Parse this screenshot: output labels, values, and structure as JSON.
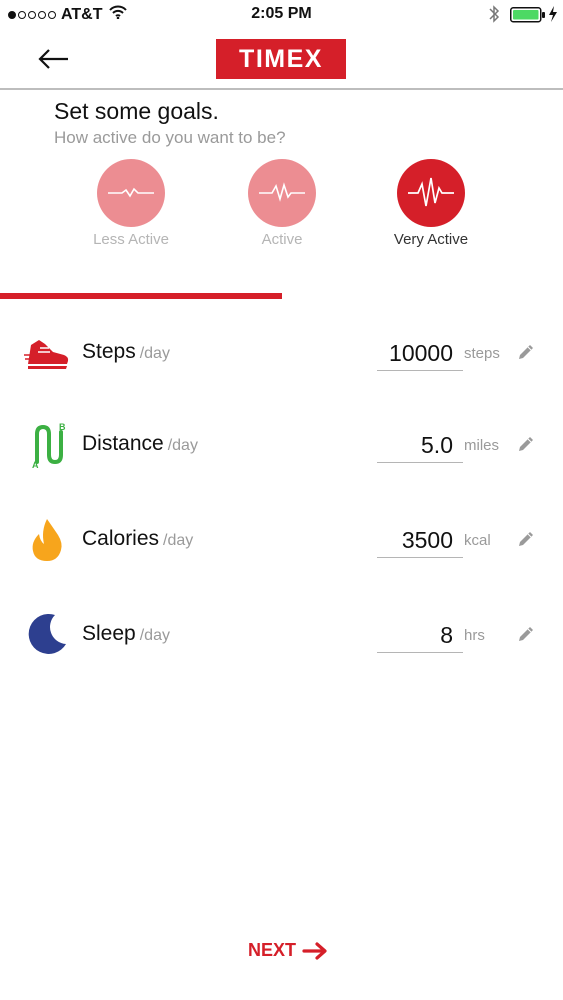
{
  "status_bar": {
    "carrier": "AT&T",
    "time": "2:05 PM",
    "signal_strength": 1,
    "battery_color": "#4cd964"
  },
  "header": {
    "logo_text": "TIMEX",
    "brand_color": "#d51f29"
  },
  "goals": {
    "title": "Set some goals.",
    "subtitle": "How active do you want to be?",
    "activity_levels": [
      {
        "label": "Less Active",
        "selected": false
      },
      {
        "label": "Active",
        "selected": false
      },
      {
        "label": "Very Active",
        "selected": true
      }
    ],
    "progress_fraction": 0.5
  },
  "goal_rows": [
    {
      "name": "Steps",
      "period": "/day",
      "value": "10000",
      "unit": "steps",
      "icon": "shoe-icon"
    },
    {
      "name": "Distance",
      "period": "/day",
      "value": "5.0",
      "unit": "miles",
      "icon": "route-icon"
    },
    {
      "name": "Calories",
      "period": "/day",
      "value": "3500",
      "unit": "kcal",
      "icon": "flame-icon"
    },
    {
      "name": "Sleep",
      "period": "/day",
      "value": "8",
      "unit": "hrs",
      "icon": "moon-icon"
    }
  ],
  "footer": {
    "next_label": "NEXT"
  }
}
